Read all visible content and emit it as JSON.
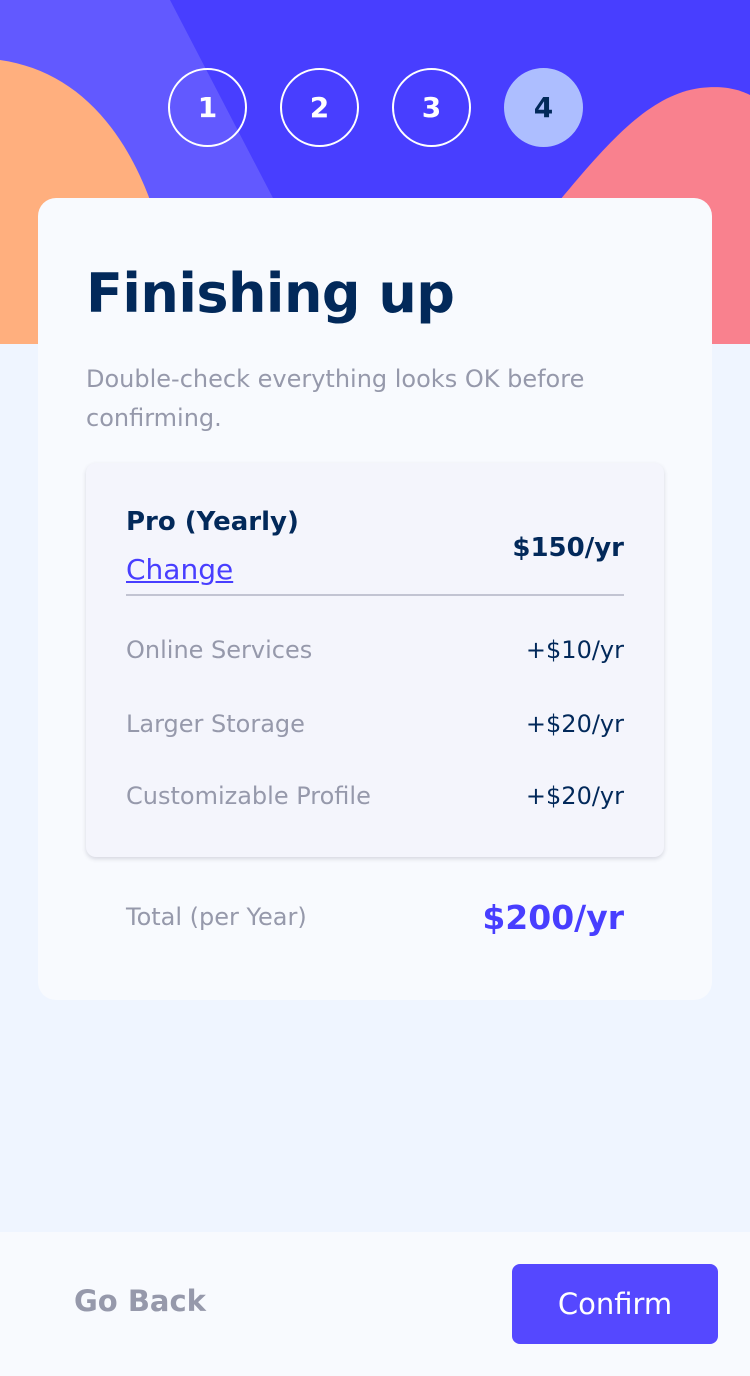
{
  "steps": [
    {
      "label": "1"
    },
    {
      "label": "2"
    },
    {
      "label": "3"
    },
    {
      "label": "4",
      "active": true
    }
  ],
  "header": {
    "title": "Finishing up",
    "subtitle": "Double-check everything looks OK before confirming."
  },
  "summary": {
    "plan": {
      "name": "Pro (Yearly)",
      "change_label": "Change",
      "price": "$150/yr"
    },
    "addons": [
      {
        "label": "Online Services",
        "price": "+$10/yr"
      },
      {
        "label": "Larger Storage",
        "price": "+$20/yr"
      },
      {
        "label": "Customizable Profile",
        "price": "+$20/yr"
      }
    ]
  },
  "total": {
    "label": "Total (per Year)",
    "price": "$200/yr"
  },
  "footer": {
    "back_label": "Go Back",
    "confirm_label": "Confirm"
  },
  "colors": {
    "accent": "#483eff",
    "marine_blue": "#02295a",
    "cool_gray": "#9699ab",
    "light_blue": "#adbeff",
    "orange": "#ffaf7e",
    "pink": "#f9818e"
  }
}
